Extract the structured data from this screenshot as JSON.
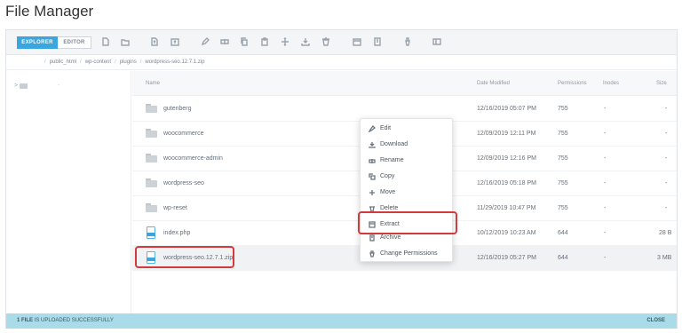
{
  "page_title": "File Manager",
  "tabs": [
    "EXPLORER",
    "EDITOR"
  ],
  "breadcrumb": [
    "public_html",
    "wp-content",
    "plugins",
    "wordpress-seo.12.7.1.zip"
  ],
  "tree": {
    "arrow": ">",
    "dash": "-"
  },
  "columns": {
    "name": "Name",
    "date": "Date Modified",
    "perms": "Permissions",
    "inodes": "Inodes",
    "size": "Size"
  },
  "files": [
    {
      "type": "folder",
      "name": "gutenberg",
      "date": "12/16/2019 05:07 PM",
      "perms": "755",
      "inodes": "-",
      "size": "-"
    },
    {
      "type": "folder",
      "name": "woocommerce",
      "date": "12/09/2019 12:11 PM",
      "perms": "755",
      "inodes": "-",
      "size": "-"
    },
    {
      "type": "folder",
      "name": "woocommerce-admin",
      "date": "12/09/2019 12:16 PM",
      "perms": "755",
      "inodes": "-",
      "size": "-"
    },
    {
      "type": "folder",
      "name": "wordpress-seo",
      "date": "12/16/2019 05:18 PM",
      "perms": "755",
      "inodes": "-",
      "size": "-"
    },
    {
      "type": "folder",
      "name": "wp-reset",
      "date": "11/29/2019 10:47 PM",
      "perms": "755",
      "inodes": "-",
      "size": "-"
    },
    {
      "type": "file",
      "name": "index.php",
      "date": "10/12/2019 10:23 AM",
      "perms": "644",
      "inodes": "-",
      "size": "28 B"
    },
    {
      "type": "file",
      "name": "wordpress-seo.12.7.1.zip",
      "date": "12/16/2019 05:27 PM",
      "perms": "644",
      "inodes": "-",
      "size": "3 MB"
    }
  ],
  "context_menu": [
    {
      "label": "Edit",
      "icon": "pencil-icon"
    },
    {
      "label": "Download",
      "icon": "download-icon"
    },
    {
      "label": "Rename",
      "icon": "rename-icon"
    },
    {
      "label": "Copy",
      "icon": "copy-icon"
    },
    {
      "label": "Move",
      "icon": "move-icon"
    },
    {
      "label": "Delete",
      "icon": "trash-icon"
    },
    {
      "label": "Extract",
      "icon": "extract-icon"
    },
    {
      "label": "Archive",
      "icon": "archive-icon"
    },
    {
      "label": "Change Permissions",
      "icon": "permissions-icon"
    }
  ],
  "status": {
    "count": "1 FILE",
    "message": " IS UPLOADED SUCCESSFULLY",
    "close": "CLOSE"
  },
  "colors": {
    "accent": "#3aa6dd",
    "highlight": "#d23b3b",
    "status_bg": "#a9dbe8"
  }
}
